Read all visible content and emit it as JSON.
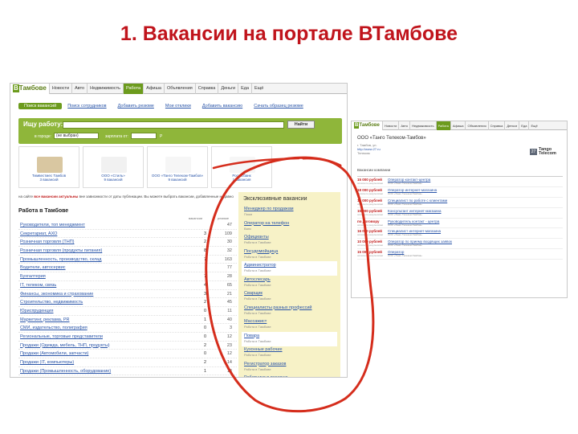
{
  "slide": {
    "title": "1. Вакансии на портале ВТамбове"
  },
  "site": {
    "logo_b": "В",
    "logo_rest": "Тамбове",
    "nav": [
      "Новости",
      "Авто",
      "Недвижимость",
      "Работа",
      "Афиша",
      "Объявления",
      "Справка",
      "Деньги",
      "Еда",
      "Ещё"
    ],
    "active_nav": "Работа"
  },
  "job": {
    "tabs": [
      "Поиск вакансий",
      "Поиск сотрудников",
      "Добавить резюме",
      "Мои отклики",
      "Добавить вакансию",
      "Сачать образец резюме"
    ],
    "search": {
      "label": "Ищу работу:",
      "button": "Найти",
      "city_label": "в городе:",
      "city_value": "(не выбран)",
      "salary_label": "зарплата от:",
      "currency": "Р"
    },
    "featured": [
      {
        "caption": "Тимвестмес Тамбов\n3 вакансий",
        "color": "#d9c7a1"
      },
      {
        "caption": "ООО «Стиль»\n9 вакансий",
        "color": "#f1f1f1"
      },
      {
        "caption": "ООО «Танго Телеком-Тамбов»\n9 вакансий",
        "color": "#f6f6f6"
      },
      {
        "caption": "Росгосбанк\n1 вакансия",
        "color": "#f6f6f6"
      }
    ],
    "note_prefix": "на сайте ",
    "note_bold": "все вакансии актуальны",
    "note_rest": " вне зависимости от даты публикации. Вы можете выбрать вакансии, добавленные недавно",
    "section_title": "Работа в Тамбове",
    "col_a": "вакансии",
    "col_b": "резюме",
    "categories": [
      {
        "name": "Руководители, топ менеджмент",
        "a": "",
        "b": "47"
      },
      {
        "name": "Секретариат, АХО",
        "a": "3",
        "b": "109"
      },
      {
        "name": "Розничная торговля (ТНП)",
        "a": "2",
        "b": "30"
      },
      {
        "name": "Розничная торговля (продукты питания)",
        "a": "8",
        "b": "32"
      },
      {
        "name": "Промышленность, производство, склад",
        "a": "7",
        "b": "163"
      },
      {
        "name": "Водители, автосервис",
        "a": "",
        "b": "77"
      },
      {
        "name": "Бухгалтерия",
        "a": "7",
        "b": "28"
      },
      {
        "name": "IT, телеком, связь",
        "a": "4",
        "b": "65"
      },
      {
        "name": "Финансы, экономика и страхование",
        "a": "3",
        "b": "21"
      },
      {
        "name": "Строительство, недвижимость",
        "a": "2",
        "b": "45"
      },
      {
        "name": "Юриспруденция",
        "a": "0",
        "b": "11"
      },
      {
        "name": "Маркетинг, реклама, PR",
        "a": "1",
        "b": "40"
      },
      {
        "name": "СМИ, издательство, полиграфия",
        "a": "0",
        "b": "3"
      },
      {
        "name": "Региональные, торговые представители",
        "a": "0",
        "b": "12"
      },
      {
        "name": "Продажи (Одежда, мебель, ТНП, продукты)",
        "a": "2",
        "b": "23"
      },
      {
        "name": "Продажи (Автомобили, запчасти)",
        "a": "0",
        "b": "12"
      },
      {
        "name": "Продажи (IT, компьютеры)",
        "a": "2",
        "b": "14"
      },
      {
        "name": "Продажи (Промышленность, оборудование)",
        "a": "1",
        "b": "13"
      }
    ],
    "exclusive_title": "Эксклюзивные вакансии",
    "exclusive": [
      {
        "title": "Менеджер по продажам",
        "company": "Пожи",
        "hl": false
      },
      {
        "title": "Оператор на телефон",
        "company": "Ванс",
        "hl": false
      },
      {
        "title": "Официанты",
        "company": "Работа в Тамбове",
        "hl": false
      },
      {
        "title": "Посудомойщица",
        "company": "Работа в Тамбове",
        "hl": false
      },
      {
        "title": "Администратор",
        "company": "Работа в Тамбове",
        "hl": true
      },
      {
        "title": "Автослесарь",
        "company": "Работа в Тамбове",
        "hl": false
      },
      {
        "title": "Сварщик",
        "company": "Работа в Тамбове",
        "hl": false
      },
      {
        "title": "Специалисты разных профессий",
        "company": "Работа в Тамбове",
        "hl": false
      },
      {
        "title": "Массажист",
        "company": "Работа в Тамбове",
        "hl": false
      },
      {
        "title": "Повара",
        "company": "Работа в Тамбове",
        "hl": true
      },
      {
        "title": "Кухонные рабочие",
        "company": "Работа в Тамбове",
        "hl": false
      },
      {
        "title": "Регистратор заказов",
        "company": "Работа в Тамбове",
        "hl": false
      },
      {
        "title": "Работники в пекарню",
        "company": "Работа в Тамбове",
        "hl": false
      }
    ]
  },
  "company": {
    "name": "ООО «Танго Телеком-Тамбов»",
    "sub1": "г. Тамбов, ул.",
    "sub2": "http://www.27.ru",
    "sub3": "Телеком",
    "logo_box": "27",
    "logo_text1": "Tango",
    "logo_text2": "Telecom",
    "section": "Вакансии компании",
    "vacancies": [
      {
        "salary": "15 000 рублей",
        "sub": "оплата по результатам",
        "title": "Оператор контакт-центра",
        "comp": "ООО «Танго Телеком-Тамбов»"
      },
      {
        "salary": "18 000 рублей",
        "sub": "оплата по результатам",
        "title": "Оператор интернет-магазина",
        "comp": "ООО «Танго Телеком-Тамбов»"
      },
      {
        "salary": "16 000 рублей",
        "sub": "оплата по результатам",
        "title": "Специалист по работе с клиентами",
        "comp": "ООО «Танго Телеком-Тамбов»"
      },
      {
        "salary": "15 000 рублей",
        "sub": "оплата по результатам",
        "title": "Консультант интернет-магазина",
        "comp": "ООО «Танго Телеком-Тамбов»"
      },
      {
        "salary": "по договору",
        "sub": "оплата по результатам",
        "title": "Руководитель контакт - центра",
        "comp": "ООО «Танго Телеком-Тамбов»"
      },
      {
        "salary": "16 000 рублей",
        "sub": "оплата по результатам",
        "title": "Специалист интернет-магазина",
        "comp": "ООО «Танго Телеком-Тамбов»"
      },
      {
        "salary": "10 000 рублей",
        "sub": "оплата по результатам",
        "title": "Оператор по приему входящих заявок",
        "comp": "ООО «Танго Телеком-Тамбов»"
      },
      {
        "salary": "15 000 рублей",
        "sub": "оплата по результатам",
        "title": "Оператор",
        "comp": "ООО «Танго Телеком-Тамбов»"
      }
    ]
  },
  "annotation": {
    "color": "#d52d1c"
  }
}
